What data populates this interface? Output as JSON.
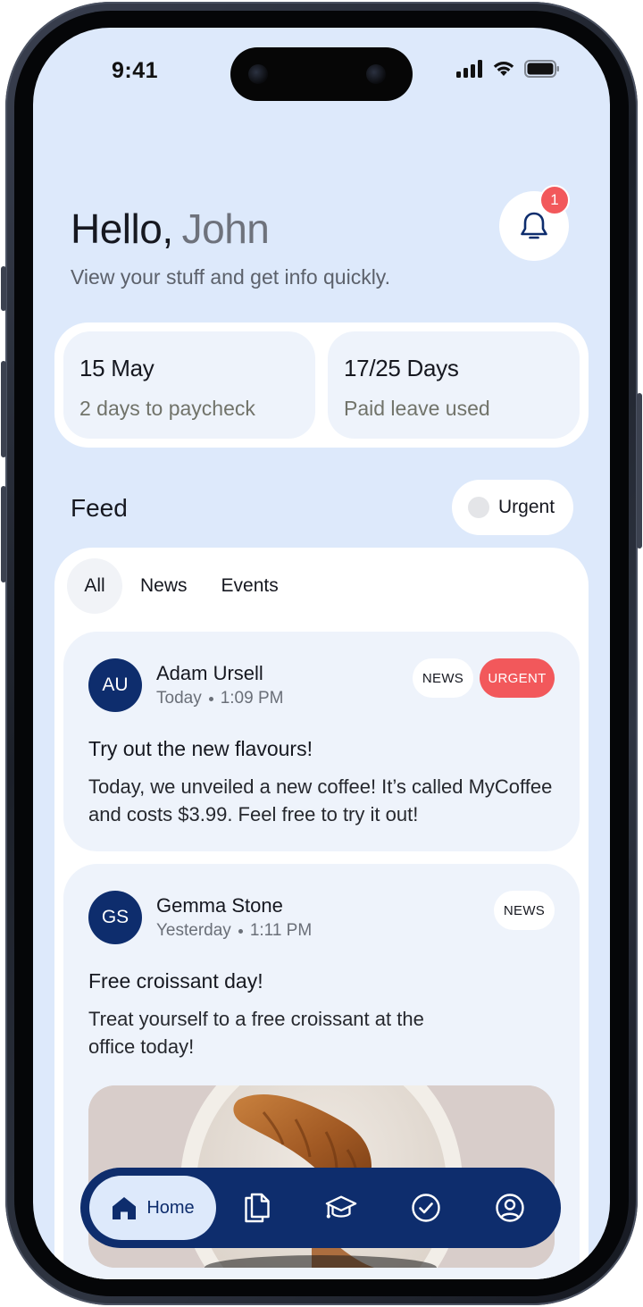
{
  "status_bar": {
    "time": "9:41"
  },
  "header": {
    "greeting": "Hello,",
    "name": "John",
    "subtitle": "View your stuff and get info quickly.",
    "notification_count": "1"
  },
  "summary": [
    {
      "title": "15 May",
      "subtitle": "2 days to paycheck"
    },
    {
      "title": "17/25 Days",
      "subtitle": "Paid leave used"
    }
  ],
  "feed": {
    "title": "Feed",
    "urgent_filter_label": "Urgent",
    "tabs": [
      "All",
      "News",
      "Events"
    ],
    "active_tab": "All",
    "posts": [
      {
        "initials": "AU",
        "author": "Adam Ursell",
        "day": "Today",
        "time": "1:09 PM",
        "tags": [
          "NEWS",
          "URGENT"
        ],
        "title": "Try out the new flavours!",
        "body": "Today, we unveiled a new coffee! It’s called MyCoffee and costs $3.99. Feel free to try it out!"
      },
      {
        "initials": "GS",
        "author": "Gemma Stone",
        "day": "Yesterday",
        "time": "1:11 PM",
        "tags": [
          "NEWS"
        ],
        "title": "Free croissant day!",
        "body": "Treat yourself to a free croissant at the office today!"
      }
    ]
  },
  "nav": {
    "home_label": "Home",
    "icons": [
      "home-icon",
      "documents-icon",
      "learning-icon",
      "tasks-icon",
      "profile-icon"
    ]
  },
  "colors": {
    "background": "#dde9fb",
    "primary": "#0e2d6d",
    "urgent": "#f2585b",
    "card": "#eef3fb"
  }
}
